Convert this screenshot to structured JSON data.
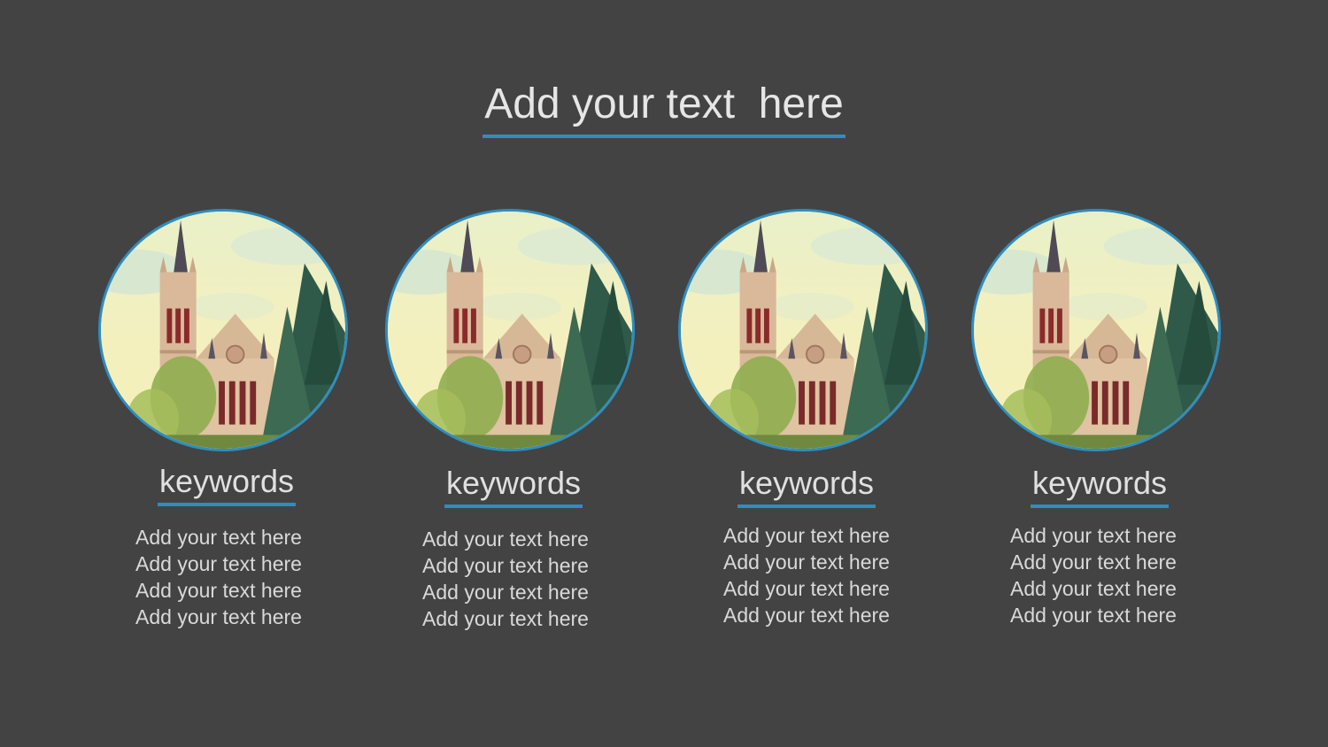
{
  "slide": {
    "title": "Add your text  here",
    "accent_color": "#2f8dbf",
    "background_color": "#434343"
  },
  "cards": [
    {
      "image_icon": "church-photo-icon",
      "keyword": "keywords",
      "lines": [
        "Add your text here",
        "Add your text here",
        "Add your text here",
        "Add your text here"
      ]
    },
    {
      "image_icon": "church-photo-icon",
      "keyword": "keywords",
      "lines": [
        "Add your text here",
        "Add your text here",
        "Add your text here",
        "Add your text here"
      ]
    },
    {
      "image_icon": "church-photo-icon",
      "keyword": "keywords",
      "lines": [
        "Add your text here",
        "Add your text here",
        "Add your text here",
        "Add your text here"
      ]
    },
    {
      "image_icon": "church-photo-icon",
      "keyword": "keywords",
      "lines": [
        "Add your text here",
        "Add your text here",
        "Add your text here",
        "Add your text here"
      ]
    }
  ]
}
